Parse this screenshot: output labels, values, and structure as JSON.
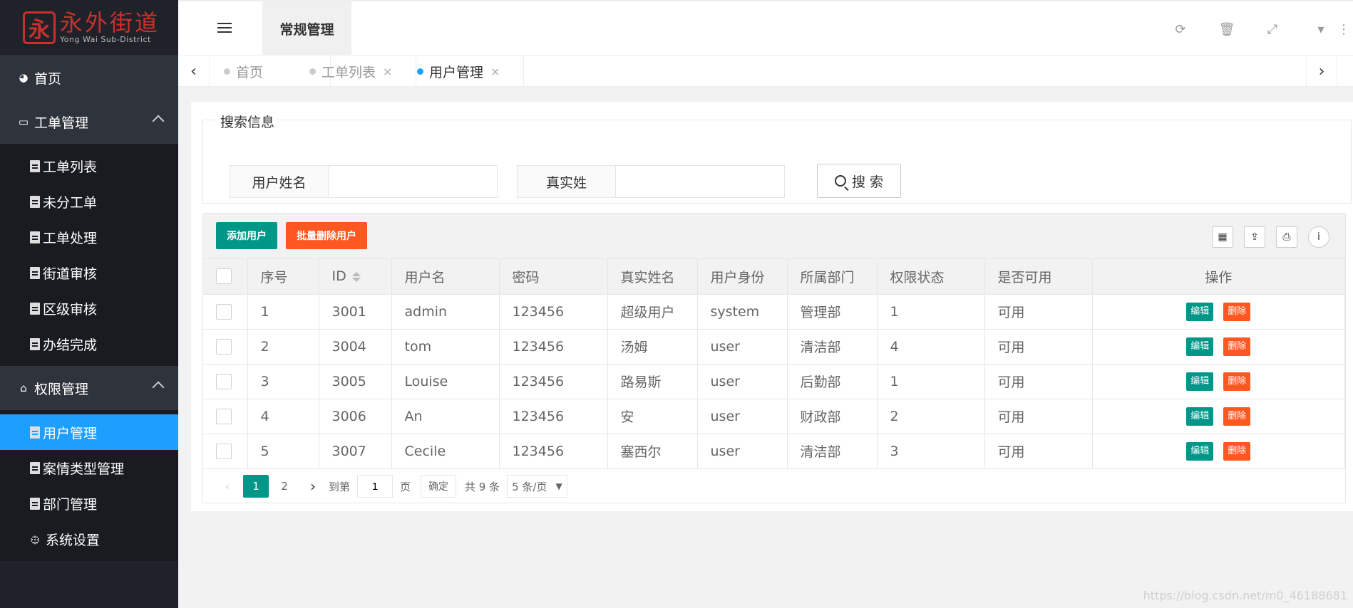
{
  "logo": {
    "main": "永外街道",
    "sub": "Yong Wai Sub-District"
  },
  "sidebar": {
    "home": "首页",
    "group1": {
      "label": "工单管理",
      "items": [
        "工单列表",
        "未分工单",
        "工单处理",
        "街道审核",
        "区级审核",
        "办结完成"
      ]
    },
    "group2": {
      "label": "权限管理",
      "items": [
        "用户管理",
        "案情类型管理",
        "部门管理",
        "系统设置"
      ]
    }
  },
  "header": {
    "tab": "常规管理"
  },
  "tabs": [
    {
      "label": "首页"
    },
    {
      "label": "工单列表",
      "close": "×"
    },
    {
      "label": "用户管理",
      "close": "×"
    }
  ],
  "search": {
    "legend": "搜索信息",
    "field1_label": "用户姓名",
    "field2_label": "真实姓",
    "button": "搜 索"
  },
  "toolbar": {
    "add": "添加用户",
    "batch_delete": "批量删除用户"
  },
  "table": {
    "headers": [
      "序号",
      "ID",
      "用户名",
      "密码",
      "真实姓名",
      "用户身份",
      "所属部门",
      "权限状态",
      "是否可用",
      "操作"
    ],
    "rows": [
      [
        "1",
        "3001",
        "admin",
        "123456",
        "超级用户",
        "system",
        "管理部",
        "1",
        "可用"
      ],
      [
        "2",
        "3004",
        "tom",
        "123456",
        "汤姆",
        "user",
        "清洁部",
        "4",
        "可用"
      ],
      [
        "3",
        "3005",
        "Louise",
        "123456",
        "路易斯",
        "user",
        "后勤部",
        "1",
        "可用"
      ],
      [
        "4",
        "3006",
        "An",
        "123456",
        "安",
        "user",
        "财政部",
        "2",
        "可用"
      ],
      [
        "5",
        "3007",
        "Cecile",
        "123456",
        "塞西尔",
        "user",
        "清洁部",
        "3",
        "可用"
      ]
    ],
    "edit": "编辑",
    "delete": "删除"
  },
  "pager": {
    "page1": "1",
    "page2": "2",
    "goto": "到第",
    "page_value": "1",
    "page_unit": "页",
    "confirm": "确定",
    "total": "共 9 条",
    "per_page": "5 条/页"
  },
  "watermark": "https://blog.csdn.net/m0_46188681"
}
